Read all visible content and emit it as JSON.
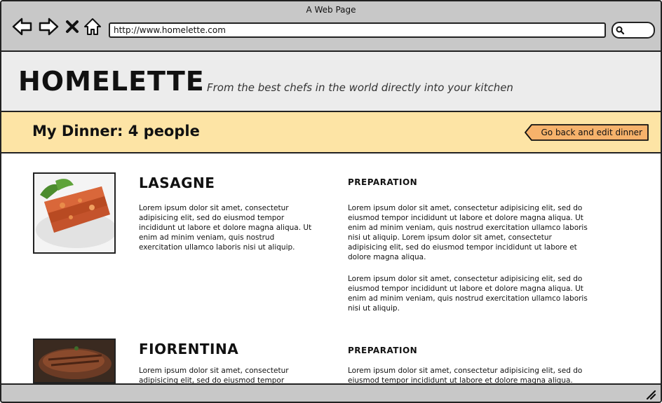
{
  "window": {
    "title": "A Web Page"
  },
  "browser": {
    "url": "http://www.homelette.com"
  },
  "header": {
    "logo": "HOMELETTE",
    "tagline": "From the best chefs in the world directly into your kitchen"
  },
  "dinner": {
    "title": "My Dinner: 4 people",
    "back_button": "Go back and edit dinner"
  },
  "dishes": [
    {
      "name": "LASAGNE",
      "description": "Lorem ipsum dolor sit amet, consectetur adipisicing elit, sed do eiusmod tempor incididunt ut labore et dolore magna aliqua. Ut enim ad minim veniam, quis nostrud exercitation ullamco laboris nisi ut aliquip.",
      "preparation_title": "PREPARATION",
      "preparation_p1": "Lorem ipsum dolor sit amet, consectetur adipisicing elit, sed do eiusmod tempor incididunt ut labore et dolore magna aliqua. Ut enim ad minim veniam, quis nostrud exercitation ullamco laboris nisi ut aliquip. Lorem ipsum dolor sit amet, consectetur adipisicing elit, sed do eiusmod tempor incididunt ut labore et dolore magna aliqua.",
      "preparation_p2": "Lorem ipsum dolor sit amet, consectetur adipisicing elit, sed do eiusmod tempor incididunt ut labore et dolore magna aliqua. Ut enim ad minim veniam, quis nostrud exercitation ullamco laboris nisi ut aliquip."
    },
    {
      "name": "FIORENTINA",
      "description": "Lorem ipsum dolor sit amet, consectetur adipisicing elit, sed do eiusmod tempor",
      "preparation_title": "PREPARATION",
      "preparation_p1": "Lorem ipsum dolor sit amet, consectetur adipisicing elit, sed do eiusmod tempor incididunt ut labore et dolore magna aliqua."
    }
  ],
  "icons": [
    "back-arrow-icon",
    "forward-arrow-icon",
    "stop-icon",
    "home-icon",
    "search-icon",
    "resize-grip-icon"
  ],
  "colors": {
    "header_bg": "#ececec",
    "dinner_bar_bg": "#fde4a5",
    "button_bg": "#f6b26b",
    "chrome_bg": "#c8c8c8"
  }
}
